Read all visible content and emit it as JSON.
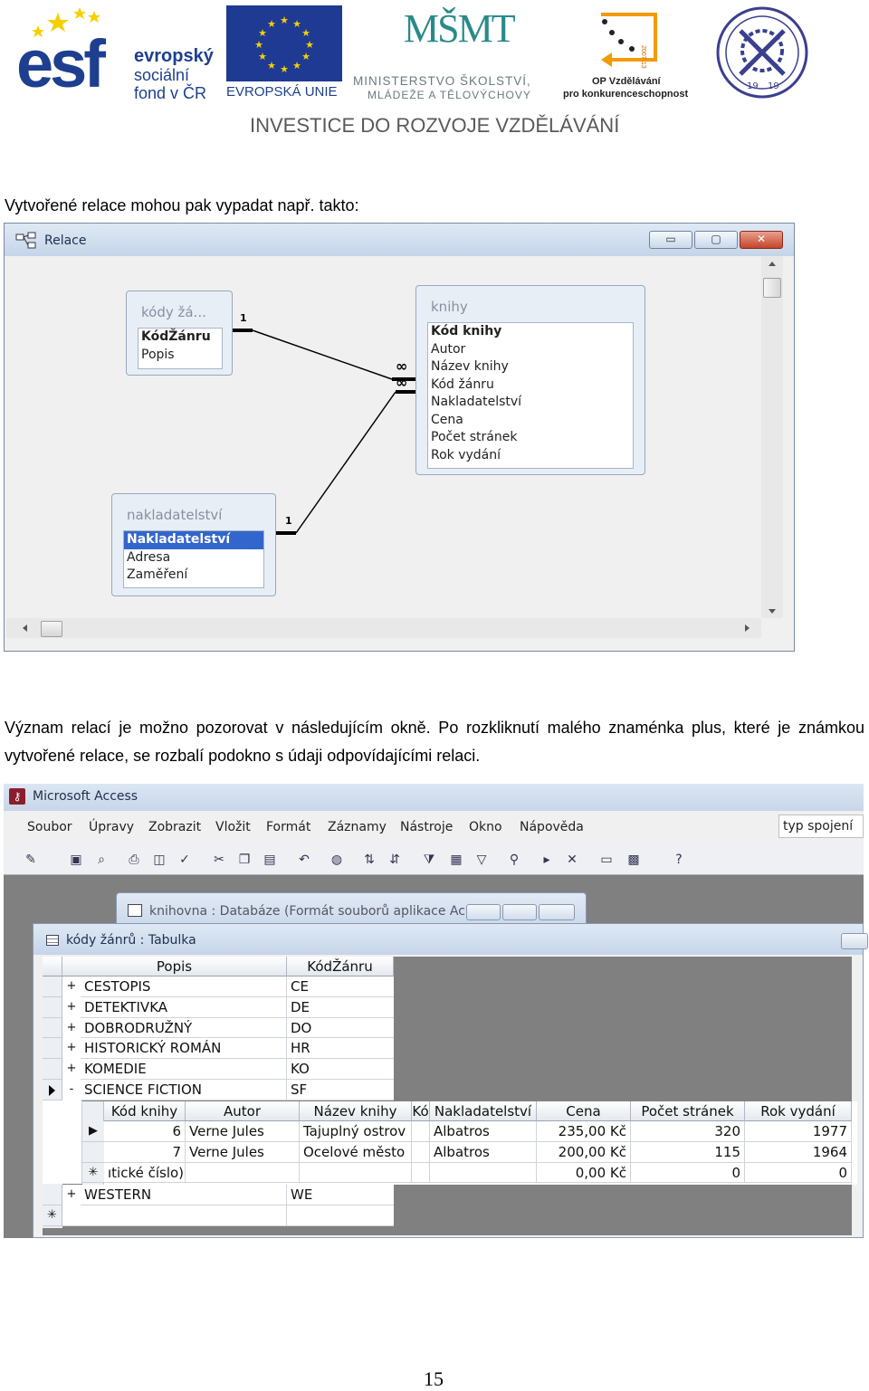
{
  "header": {
    "esf": {
      "letters": "esf",
      "line1": "evropský",
      "line2": "sociální",
      "line3": "fond v ČR"
    },
    "eu": {
      "label": "EVROPSKÁ UNIE"
    },
    "msmt": {
      "letters": "MŠMT",
      "line1": "MINISTERSTVO ŠKOLSTVÍ,",
      "line2": "MLÁDEŽE A TĚLOVÝCHOVY"
    },
    "op": {
      "line1": "OP Vzdělávání",
      "line2": "pro konkurenceschopnost",
      "years": "2007-13"
    },
    "seal": {
      "year_left": "19",
      "year_right": "19"
    },
    "tagline": "INVESTICE DO ROZVOJE VZDĚLÁVÁNÍ"
  },
  "intro_text": "Vytvořené relace mohou pak vypadat např. takto:",
  "relace_window": {
    "title": "Relace",
    "buttons": {
      "minimize": "▭",
      "maximize": "▢",
      "close": "✕"
    },
    "tables": [
      {
        "caption": "kódy žá...",
        "fields": [
          "KódŽánru",
          "Popis"
        ]
      },
      {
        "caption": "knihy",
        "fields": [
          "Kód knihy",
          "Autor",
          "Název knihy",
          "Kód žánru",
          "Nakladatelství",
          "Cena",
          "Počet stránek",
          "Rok vydání"
        ]
      },
      {
        "caption": "nakladatelství",
        "fields": [
          "Nakladatelství",
          "Adresa",
          "Zaměření"
        ]
      }
    ],
    "relations": [
      {
        "one": "1",
        "many": "∞"
      },
      {
        "one": "1",
        "many": "∞"
      }
    ]
  },
  "paragraph_text": "Význam relací je možno pozorovat v následujícím okně. Po rozkliknutí malého znaménka plus, které je známkou vytvořené relace, se rozbalí podokno s údaji odpovídajícími relaci.",
  "access_window": {
    "title": "Microsoft Access",
    "menu": [
      "Soubor",
      "Úpravy",
      "Zobrazit",
      "Vložit",
      "Formát",
      "Záznamy",
      "Nástroje",
      "Okno",
      "Nápověda"
    ],
    "help_box": "typ spojení",
    "db_window_title": "knihovna : Databáze (Formát souborů aplikace Ac...",
    "table_window_title": "kódy žánrů : Tabulka",
    "columns": [
      "Popis",
      "KódŽánru"
    ],
    "rows": [
      {
        "marker": "+",
        "popis": "CESTOPIS",
        "kod": "CE"
      },
      {
        "marker": "+",
        "popis": "DETEKTIVKA",
        "kod": "DE"
      },
      {
        "marker": "+",
        "popis": "DOBRODRUŽNÝ",
        "kod": "DO"
      },
      {
        "marker": "+",
        "popis": "HISTORICKÝ ROMÁN",
        "kod": "HR"
      },
      {
        "marker": "+",
        "popis": "KOMEDIE",
        "kod": "KO"
      },
      {
        "marker": "-",
        "popis": "SCIENCE FICTION",
        "kod": "SF"
      }
    ],
    "sub_columns": [
      "Kód knihy",
      "Autor",
      "Název knihy",
      "Kó",
      "Nakladatelství",
      "Cena",
      "Počet stránek",
      "Rok vydání"
    ],
    "sub_rows": [
      {
        "marker": "▶",
        "kod": "6",
        "autor": "Verne Jules",
        "nazev": "Tajuplný ostrov",
        "nakl": "Albatros",
        "cena": "235,00 Kč",
        "pocet": "320",
        "rok": "1977"
      },
      {
        "marker": "",
        "kod": "7",
        "autor": "Verne Jules",
        "nazev": "Ocelové město",
        "nakl": "Albatros",
        "cena": "200,00 Kč",
        "pocet": "115",
        "rok": "1964"
      },
      {
        "marker": "✳",
        "kod": "ıtické číslo)",
        "autor": "",
        "nazev": "",
        "nakl": "",
        "cena": "0,00 Kč",
        "pocet": "0",
        "rok": "0"
      }
    ],
    "last_row": {
      "marker": "+",
      "popis": "WESTERN",
      "kod": "WE"
    },
    "new_row_marker": "✳"
  },
  "page_number": "15"
}
